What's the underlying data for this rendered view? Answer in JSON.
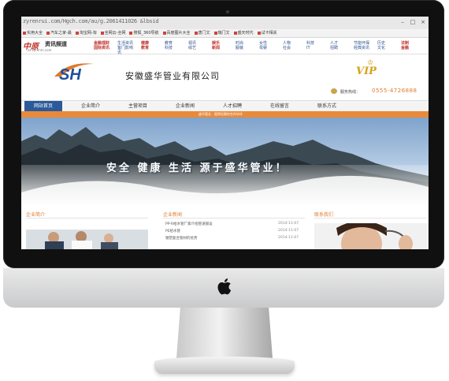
{
  "browser": {
    "url": "zyrenrui.com/Hgch.com/au/g.2061411026 &lbsid",
    "bookmarks": [
      "实用大全",
      "汽车之家-最",
      "淘宝网-淘",
      "全网云-全网",
      "搜狐_360导航",
      "百度图片大全",
      "唐门文",
      "瑞门文",
      "盛天时代",
      "试卡相关 "
    ]
  },
  "top_strip": {
    "logo_text": "中原",
    "logo_sub": "资讯频道",
    "logo_url": "zx.zyrenm.com",
    "nav_groups": [
      {
        "a": "金融理财",
        "b": "国际资讯",
        "color": "red"
      },
      {
        "a": "生活资讯",
        "b": "客门影响讯",
        "color": "blue"
      },
      {
        "a": "健康",
        "b": "教育",
        "color": "red"
      },
      {
        "a": "教育",
        "b": "科技",
        "color": "blue"
      },
      {
        "a": "视讯",
        "b": "综艺",
        "color": "blue"
      },
      {
        "a": "娱乐",
        "b": "新闻",
        "color": "red"
      },
      {
        "a": "时尚",
        "b": "服装",
        "color": "blue"
      },
      {
        "a": "女性",
        "b": "母婴",
        "color": "blue"
      },
      {
        "a": "人物",
        "b": "社会",
        "color": "blue"
      },
      {
        "a": "科技",
        "b": "IT",
        "color": "blue"
      },
      {
        "a": "人才",
        "b": "招聘",
        "color": "blue"
      },
      {
        "a": "节能环保",
        "b": "经典资讯",
        "color": "blue"
      },
      {
        "a": "历史",
        "b": "文化",
        "color": "blue"
      },
      {
        "a": "法制",
        "b": "金融",
        "color": "red"
      }
    ]
  },
  "header": {
    "logo": "SH",
    "company_name": "安徽盛华管业有限公司",
    "vip": "VIP",
    "hotline_label": "服务热线：",
    "hotline": "0555-4726888"
  },
  "nav": {
    "items": [
      "网站首页",
      "企业简介",
      "主营项目",
      "企业新闻",
      "人才招聘",
      "在线留言",
      "联系方式"
    ],
    "active_index": 0
  },
  "sub_bar_text": "盛华管业 · 值得信赖的合作伙伴",
  "hero": {
    "slogan": "安全  健康  生活  源于盛华管业！"
  },
  "content": {
    "left_title": "企业简介",
    "mid_title": "企业新闻",
    "right_title": "联系我们",
    "news": [
      {
        "title": "PP-R给水管厂家介绍管道铺设",
        "date": "2014-11-07"
      },
      {
        "title": "PE给水管",
        "date": "2014-11-07"
      },
      {
        "title": "钢塑复合管材的优势",
        "date": "2014-11-07"
      }
    ]
  },
  "colors": {
    "nav_active": "#2a5a9a",
    "accent_orange": "#e98a3b",
    "logo_red": "#c0322b",
    "vip_gold": "#d4a31a"
  }
}
